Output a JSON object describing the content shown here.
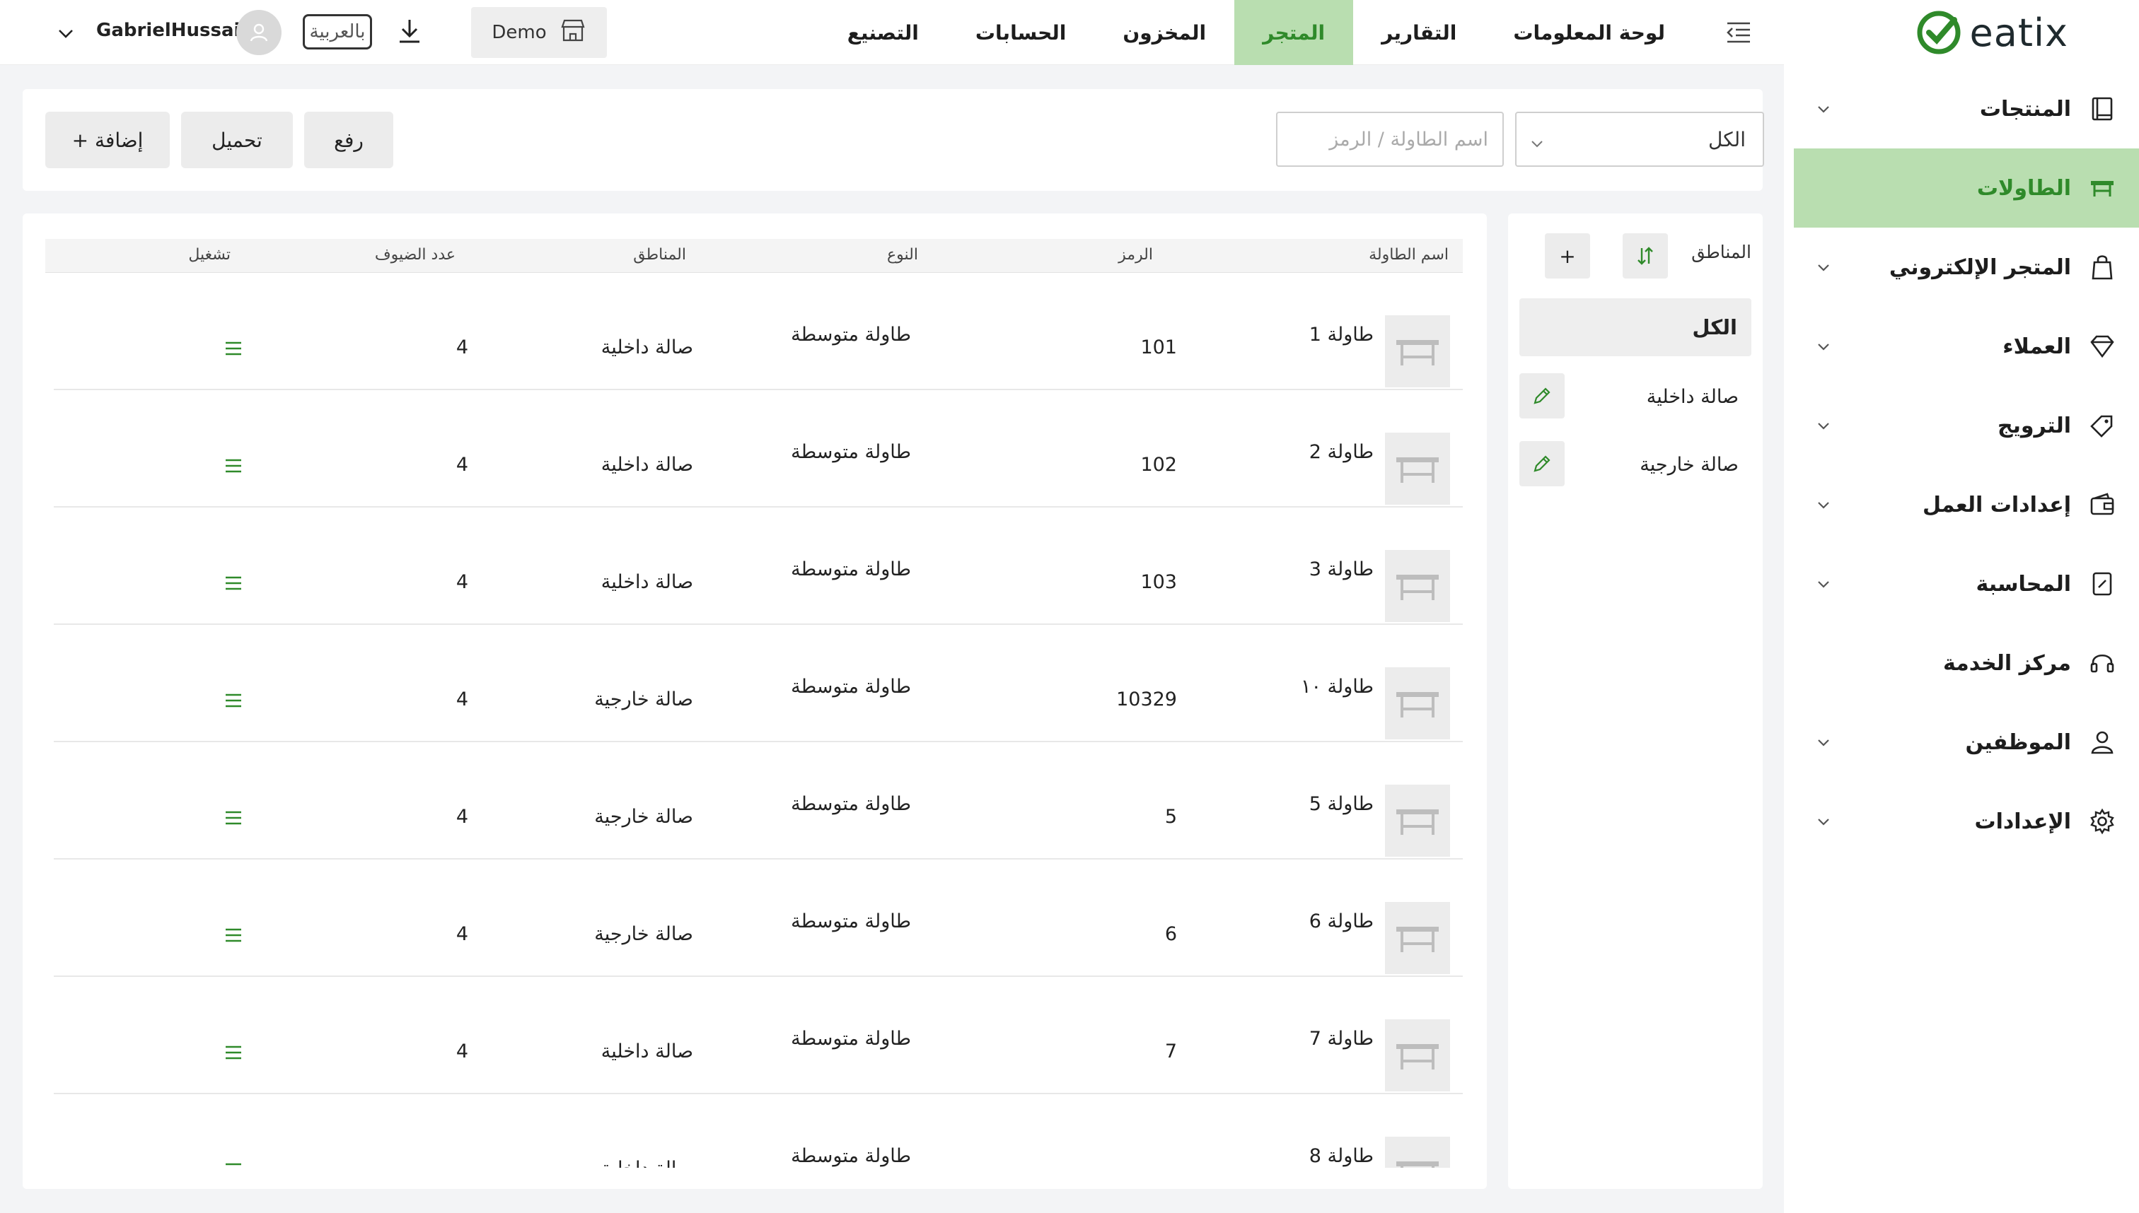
{
  "brand": {
    "name": "eatix"
  },
  "sidebar": {
    "items": [
      {
        "label": "المنتجات",
        "icon": "book-icon",
        "expandable": true
      },
      {
        "label": "الطاولات",
        "icon": "table-icon",
        "expandable": false,
        "active": true
      },
      {
        "label": "المتجر الإلكتروني",
        "icon": "shopping-bag-icon",
        "expandable": true
      },
      {
        "label": "العملاء",
        "icon": "diamond-icon",
        "expandable": true
      },
      {
        "label": "الترويج",
        "icon": "tag-icon",
        "expandable": true
      },
      {
        "label": "إعدادات العمل",
        "icon": "wallet-icon",
        "expandable": true
      },
      {
        "label": "المحاسبة",
        "icon": "calculator-icon",
        "expandable": true
      },
      {
        "label": "مركز الخدمة",
        "icon": "headset-icon",
        "expandable": false
      },
      {
        "label": "الموظفين",
        "icon": "user-icon",
        "expandable": true
      },
      {
        "label": "الإعدادات",
        "icon": "gear-icon",
        "expandable": true
      }
    ]
  },
  "topbar": {
    "nav": [
      {
        "label": "لوحة المعلومات",
        "active": false
      },
      {
        "label": "التقارير",
        "active": false
      },
      {
        "label": "المتجر",
        "active": true
      },
      {
        "label": "المخزون",
        "active": false
      },
      {
        "label": "الحسابات",
        "active": false
      },
      {
        "label": "التصنيع",
        "active": false
      }
    ],
    "store_label": "Demo",
    "language_label": "بالعربية",
    "username": "GabrielHussain"
  },
  "filters": {
    "zone_select_value": "الكل",
    "search_placeholder": "اسم الطاولة / الرمز",
    "upload_label": "رفع",
    "download_label": "تحميل",
    "add_label": "+ إضافة"
  },
  "zones": {
    "title": "المناطق",
    "add_label": "+",
    "all_label": "الكل",
    "items": [
      {
        "label": "صالة داخلية"
      },
      {
        "label": "صالة خارجية"
      }
    ]
  },
  "table": {
    "columns": {
      "name": "اسم الطاولة",
      "code": "الرمز",
      "type": "النوع",
      "zone": "المناطق",
      "guests": "عدد الضيوف",
      "operation": "تشغيل"
    },
    "rows": [
      {
        "name": "طاولة 1",
        "code": "101",
        "type": "طاولة متوسطة",
        "zone": "صالة داخلية",
        "guests": "4"
      },
      {
        "name": "طاولة 2",
        "code": "102",
        "type": "طاولة متوسطة",
        "zone": "صالة داخلية",
        "guests": "4"
      },
      {
        "name": "طاولة 3",
        "code": "103",
        "type": "طاولة متوسطة",
        "zone": "صالة داخلية",
        "guests": "4"
      },
      {
        "name": "طاولة ١٠",
        "code": "10329",
        "type": "طاولة متوسطة",
        "zone": "صالة خارجية",
        "guests": "4"
      },
      {
        "name": "طاولة 5",
        "code": "5",
        "type": "طاولة متوسطة",
        "zone": "صالة خارجية",
        "guests": "4"
      },
      {
        "name": "طاولة 6",
        "code": "6",
        "type": "طاولة متوسطة",
        "zone": "صالة خارجية",
        "guests": "4"
      },
      {
        "name": "طاولة 7",
        "code": "7",
        "type": "طاولة متوسطة",
        "zone": "صالة داخلية",
        "guests": "4"
      },
      {
        "name": "طاولة 8",
        "code": "",
        "type": "طاولة متوسطة",
        "zone": "صالة داخلية",
        "guests": ""
      }
    ]
  },
  "colors": {
    "accent": "#2f8a2a",
    "active_bg": "#b9deb0",
    "page_bg": "#f3f4f6"
  }
}
